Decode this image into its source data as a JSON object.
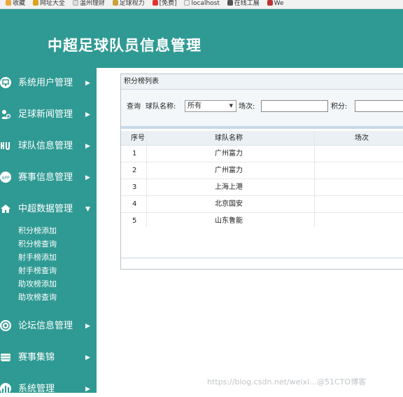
{
  "bookmarks": [
    "收藏",
    "网址大全",
    "温州理财",
    "足球视力",
    "[免费]",
    "localhost",
    "在线工展",
    "We"
  ],
  "header": {
    "title": "中超足球队员信息管理"
  },
  "sidebar": {
    "items": [
      {
        "label": "系统用户管理",
        "icon": "monitor-icon"
      },
      {
        "label": "足球新闻管理",
        "icon": "user-gear-icon"
      },
      {
        "label": "球队信息管理",
        "icon": "team-icon"
      },
      {
        "label": "赛事信息管理",
        "icon": "app-icon"
      },
      {
        "label": "中超数据管理",
        "icon": "home-icon",
        "expanded": true
      },
      {
        "label": "论坛信息管理",
        "icon": "target-icon"
      },
      {
        "label": "赛事集锦",
        "icon": "stack-icon"
      },
      {
        "label": "系统管理",
        "icon": "chart-icon"
      }
    ],
    "sub_items": [
      "积分榜添加",
      "积分榜查询",
      "射手榜添加",
      "射手榜查询",
      "助攻榜添加",
      "助攻榜查询"
    ]
  },
  "panel": {
    "title": "积分榜列表",
    "search": {
      "query_label": "查询",
      "team_label": "球队名称:",
      "team_selected": "所有",
      "matches_label": "场次:",
      "matches_value": "",
      "points_label": "积分:",
      "points_value": ""
    },
    "table": {
      "headers": [
        "序号",
        "球队名称",
        "场次"
      ],
      "rows": [
        {
          "index": "1",
          "team": "广州富力",
          "matches": ""
        },
        {
          "index": "2",
          "team": "广州富力",
          "matches": ""
        },
        {
          "index": "3",
          "team": "上海上港",
          "matches": ""
        },
        {
          "index": "4",
          "team": "北京国安",
          "matches": ""
        },
        {
          "index": "5",
          "team": "山东鲁能",
          "matches": ""
        }
      ]
    }
  },
  "watermark": "https://blog.csdn.net/weixi…@51CTO博客",
  "colors": {
    "teal": "#2f9a93",
    "panel_header": "#eef3f7"
  }
}
